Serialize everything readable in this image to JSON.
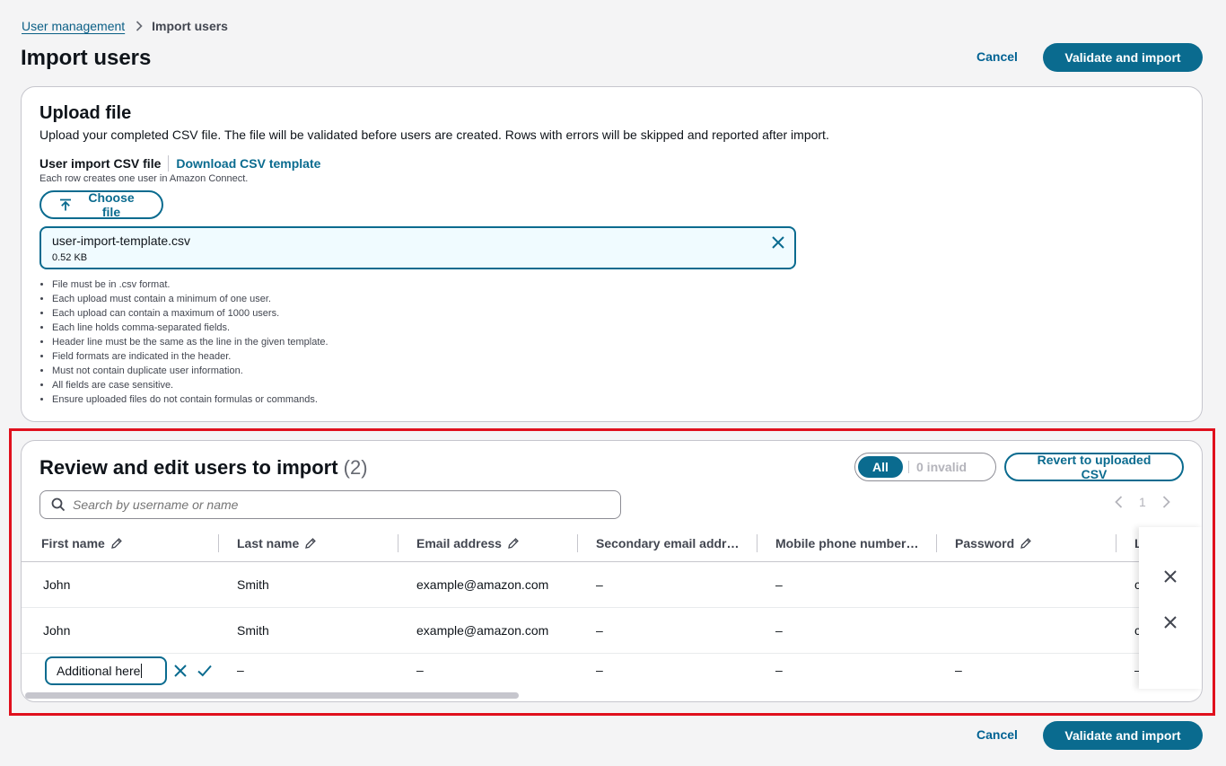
{
  "breadcrumb": {
    "parent": "User management",
    "current": "Import users"
  },
  "page": {
    "title": "Import users",
    "cancel_label": "Cancel",
    "submit_label": "Validate and import"
  },
  "upload": {
    "title": "Upload file",
    "description": "Upload your completed CSV file. The file will be validated before users are created. Rows with errors will be skipped and reported after import.",
    "field_label": "User import CSV file",
    "download_link": "Download CSV template",
    "field_hint": "Each row creates one user in Amazon Connect.",
    "choose_label": "Choose file",
    "file_name": "user-import-template.csv",
    "file_size": "0.52 KB",
    "constraints": [
      "File must be in .csv format.",
      "Each upload must contain a minimum of one user.",
      "Each upload can contain a maximum of 1000 users.",
      "Each line holds comma-separated fields.",
      "Header line must be the same as the line in the given template.",
      "Field formats are indicated in the header.",
      "Must not contain duplicate user information.",
      "All fields are case sensitive.",
      "Ensure uploaded files do not contain formulas or commands."
    ]
  },
  "review": {
    "title": "Review and edit users to import",
    "count": "(2)",
    "filter_all": "All",
    "filter_invalid": "0 invalid",
    "revert_label": "Revert to uploaded CSV",
    "search_placeholder": "Search by username or name",
    "page_number": "1",
    "columns": [
      "First name",
      "Last name",
      "Email address",
      "Secondary email addr…",
      "Mobile phone number…",
      "Password",
      "L"
    ],
    "rows": [
      {
        "first": "John",
        "last": "Smith",
        "email": "example@amazon.com",
        "secondary": "–",
        "mobile": "–",
        "password": "",
        "next": "c"
      },
      {
        "first": "John",
        "last": "Smith",
        "email": "example@amazon.com",
        "secondary": "–",
        "mobile": "–",
        "password": "",
        "next": "c"
      }
    ],
    "edit_row": {
      "first_value": "Additional here",
      "last": "–",
      "email": "–",
      "secondary": "–",
      "mobile": "–",
      "password": "–",
      "next": "–"
    }
  },
  "colors": {
    "primary": "#0a6b8f",
    "highlight": "#e0101d"
  }
}
